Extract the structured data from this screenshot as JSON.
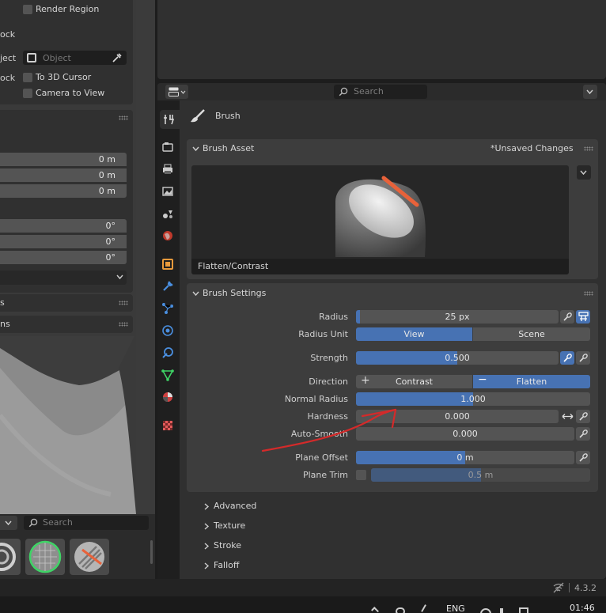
{
  "left_panel": {
    "render_region": "Render Region",
    "lock_heading": "ock",
    "object_label": "ject",
    "object_placeholder": "Object",
    "lock_label": "ock",
    "to_3d_cursor": "To 3D Cursor",
    "camera_to_view": "Camera to View",
    "location_values": [
      "0 m",
      "0 m",
      "0 m"
    ],
    "rotation_values": [
      "0°",
      "0°",
      "0°"
    ],
    "collapsed_panels": [
      "s",
      "ns"
    ],
    "search_placeholder": "Search"
  },
  "properties": {
    "search_placeholder": "Search",
    "context_title": "Brush",
    "brush_asset": {
      "header": "Brush Asset",
      "unsaved": "*Unsaved Changes",
      "brush_name": "Flatten/Contrast"
    },
    "brush_settings": {
      "header": "Brush Settings",
      "radius_label": "Radius",
      "radius_value": "25 px",
      "radius_fill": 0.02,
      "radius_unit_label": "Radius Unit",
      "unit_view": "View",
      "unit_scene": "Scene",
      "strength_label": "Strength",
      "strength_value": "0.500",
      "strength_fill": 0.5,
      "direction_label": "Direction",
      "dir_contrast": "Contrast",
      "dir_flatten": "Flatten",
      "normal_radius_label": "Normal Radius",
      "normal_radius_value": "1.000",
      "normal_radius_fill": 0.5,
      "hardness_label": "Hardness",
      "hardness_value": "0.000",
      "auto_smooth_label": "Auto-Smooth",
      "auto_smooth_value": "0.000",
      "plane_offset_label": "Plane Offset",
      "plane_offset_value": "0 m",
      "plane_offset_fill": 0.5,
      "plane_trim_label": "Plane Trim",
      "plane_trim_value": "0.5 m",
      "plane_trim_fill": 0.5
    },
    "subpanels": [
      "Advanced",
      "Texture",
      "Stroke",
      "Falloff"
    ]
  },
  "status_bar": {
    "version": "4.3.2"
  },
  "taskbar": {
    "language": "ENG",
    "time": "01:46"
  },
  "colors": {
    "accent": "#4772b3",
    "panel_bg": "#303030",
    "field_bg": "#545454",
    "brush_tip": "#e8623a"
  }
}
